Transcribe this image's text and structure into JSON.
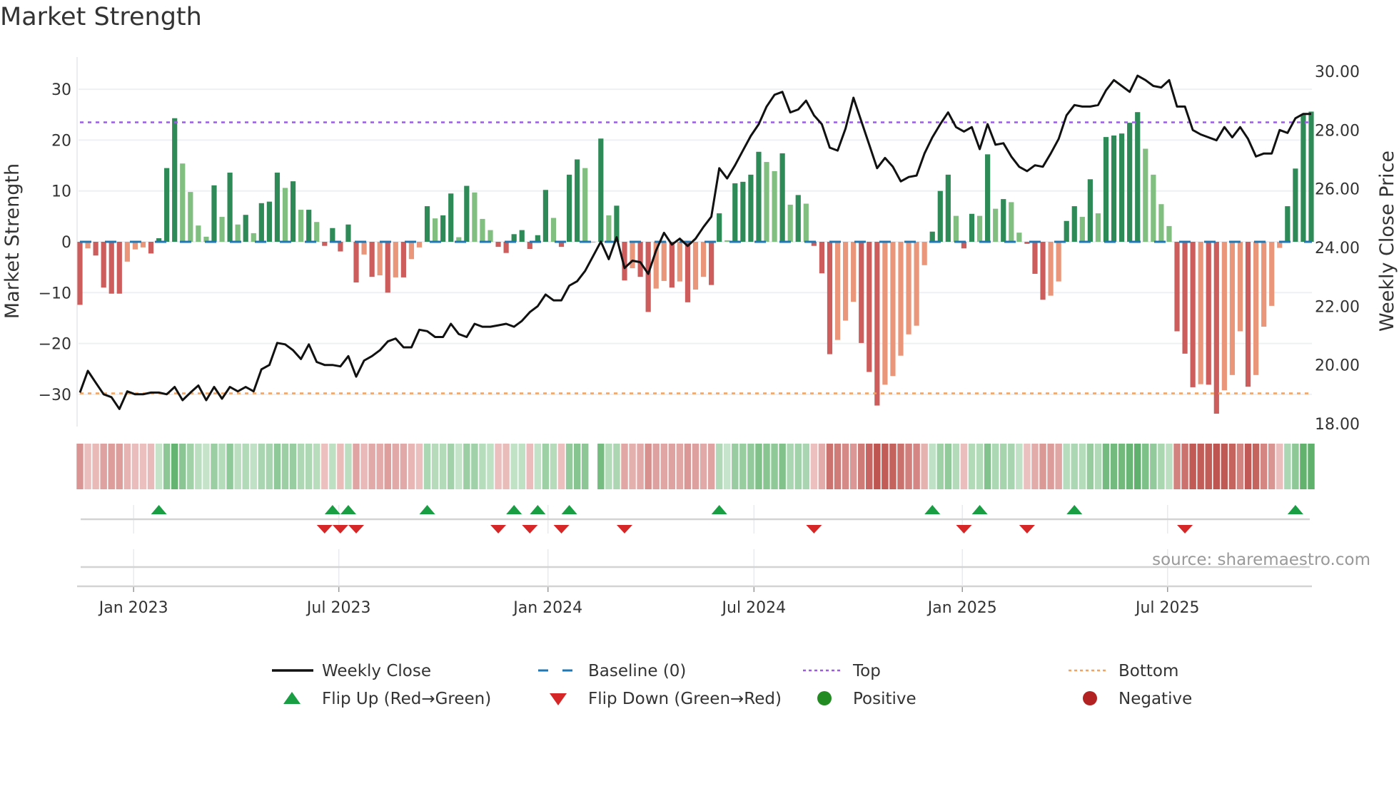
{
  "chart_data": {
    "type": "bar",
    "title": "Market Strength",
    "ylabel": "Market Strength",
    "y2label": "Weekly Close Price",
    "ylim": [
      -37,
      36
    ],
    "y2lim": [
      18,
      30.6
    ],
    "yticks": [
      "30",
      "20",
      "10",
      "0",
      "−10",
      "−20",
      "−30"
    ],
    "ytick_values": [
      30,
      20,
      10,
      0,
      -10,
      -20,
      -30
    ],
    "y2ticks": [
      "30.00",
      "28.00",
      "26.00",
      "24.00",
      "22.00",
      "20.00",
      "18.00"
    ],
    "y2tick_values": [
      30,
      28,
      26,
      24,
      22,
      20,
      18
    ],
    "xticks": [
      "Jan 2023",
      "Jul 2023",
      "Jan 2024",
      "Jul 2024",
      "Jan 2025",
      "Jul 2025"
    ],
    "xtick_week_index": [
      6.8,
      32.8,
      59.3,
      85.4,
      111.8,
      137.8
    ],
    "top_level": 23.5,
    "bottom_level": -29.8,
    "baseline": 0,
    "grid": true,
    "legend_placement": "bottom",
    "strength": [
      -12.4,
      -1.3,
      -2.7,
      -9,
      -10.2,
      -10.2,
      -3.9,
      -1.5,
      -1.1,
      -2.3,
      0.7,
      14.5,
      24.3,
      15.4,
      9.8,
      3.2,
      1.0,
      11.1,
      4.9,
      13.6,
      3.4,
      5.3,
      1.7,
      7.6,
      7.9,
      13.6,
      10.6,
      11.9,
      6.3,
      6.3,
      3.9,
      -0.8,
      2.7,
      -1.9,
      3.4,
      -8,
      -2.5,
      -6.9,
      -6.6,
      -10,
      -7,
      -7,
      -3.4,
      -1.1,
      7.0,
      4.6,
      5.2,
      9.5,
      0.9,
      11.0,
      9.7,
      4.5,
      2.3,
      -1,
      -2.2,
      1.5,
      2.3,
      -1.4,
      1.3,
      10.2,
      4.7,
      -1,
      13.2,
      16.2,
      14.5,
      0,
      20.3,
      5.2,
      7.1,
      -7.6,
      -5.2,
      -6.9,
      -13.8,
      -9.2,
      -7.7,
      -9,
      -7.8,
      -11.9,
      -9.4,
      -6.9,
      -8.5,
      5.6,
      0.3,
      11.5,
      11.8,
      13.2,
      17.7,
      15.7,
      13.9,
      17.4,
      7.3,
      9.2,
      7.5,
      -0.8,
      -6.2,
      -22.1,
      -19.3,
      -15.5,
      -11.8,
      -19.9,
      -25.6,
      -32.2,
      -28.1,
      -26.4,
      -22.4,
      -18.2,
      -16.5,
      -4.6,
      2.0,
      10.0,
      13.2,
      5.1,
      -1.3,
      5.5,
      5.1,
      17.2,
      6.5,
      8.4,
      7.8,
      1.8,
      -0.4,
      -6.3,
      -11.4,
      -10.6,
      -7.8,
      4.1,
      7.0,
      4.9,
      12.3,
      5.6,
      20.6,
      20.9,
      21.3,
      23.4,
      25.5,
      18.3,
      13.2,
      7.4,
      3.1,
      -17.6,
      -22.0,
      -28.6,
      -28.0,
      -28.1,
      -33.8,
      -29.2,
      -26.2,
      -17.6,
      -28.5,
      -26.2,
      -16.7,
      -12.6,
      -1.2,
      7.0,
      14.4,
      25.1,
      25.6
    ],
    "weekly_close": [
      19.06,
      19.8,
      19.4,
      19.0,
      18.9,
      18.5,
      19.1,
      19.0,
      19.0,
      19.06,
      19.06,
      19.0,
      19.25,
      18.8,
      19.06,
      19.3,
      18.8,
      19.25,
      18.85,
      19.25,
      19.1,
      19.25,
      19.1,
      19.85,
      20.0,
      20.75,
      20.7,
      20.5,
      20.2,
      20.7,
      20.1,
      20.0,
      20.0,
      19.95,
      20.3,
      19.6,
      20.15,
      20.3,
      20.5,
      20.8,
      20.9,
      20.6,
      20.6,
      21.2,
      21.15,
      20.95,
      20.95,
      21.4,
      21.05,
      20.95,
      21.4,
      21.3,
      21.3,
      21.35,
      21.4,
      21.3,
      21.5,
      21.8,
      22.0,
      22.4,
      22.2,
      22.2,
      22.7,
      22.85,
      23.2,
      23.7,
      24.2,
      23.6,
      24.35,
      23.3,
      23.55,
      23.5,
      23.1,
      23.9,
      24.5,
      24.1,
      24.3,
      24.05,
      24.3,
      24.7,
      25.05,
      26.7,
      26.35,
      26.8,
      27.3,
      27.8,
      28.2,
      28.8,
      29.2,
      29.3,
      28.6,
      28.7,
      29.0,
      28.5,
      28.2,
      27.4,
      27.3,
      28.05,
      29.1,
      28.3,
      27.5,
      26.7,
      27.05,
      26.75,
      26.25,
      26.4,
      26.45,
      27.2,
      27.75,
      28.2,
      28.6,
      28.1,
      27.95,
      28.1,
      27.35,
      28.2,
      27.5,
      27.55,
      27.1,
      26.75,
      26.6,
      26.8,
      26.75,
      27.2,
      27.7,
      28.5,
      28.85,
      28.8,
      28.8,
      28.85,
      29.35,
      29.7,
      29.5,
      29.3,
      29.85,
      29.7,
      29.5,
      29.45,
      29.7,
      28.8,
      28.8,
      28.0,
      27.85,
      27.75,
      27.65,
      28.1,
      27.75,
      28.1,
      27.7,
      27.1,
      27.2,
      27.2,
      28.0,
      27.9,
      28.4,
      28.55,
      28.55
    ],
    "flip_up_week_index": [
      10,
      32,
      34,
      44,
      55,
      58,
      62,
      81,
      108,
      114,
      126,
      154
    ],
    "flip_down_week_index": [
      31,
      33,
      35,
      53,
      57,
      61,
      69,
      93,
      112,
      120,
      140
    ],
    "legend": [
      {
        "label": "Weekly Close",
        "marker": "line",
        "color": "#111111"
      },
      {
        "label": "Baseline (0)",
        "marker": "dash",
        "color": "#1f77b4"
      },
      {
        "label": "Top",
        "marker": "dot",
        "color": "#9b5de5"
      },
      {
        "label": "Bottom",
        "marker": "dot",
        "color": "#f4a261"
      },
      {
        "label": "Flip Up (Red→Green)",
        "marker": "triangle-up",
        "color": "#1a9e44"
      },
      {
        "label": "Flip Down (Green→Red)",
        "marker": "triangle-down",
        "color": "#d62728"
      },
      {
        "label": "Positive",
        "marker": "circle",
        "color": "#228b22"
      },
      {
        "label": "Negative",
        "marker": "circle",
        "color": "#b22222"
      }
    ],
    "colors": {
      "pos_strong": "#2e8b57",
      "pos_weak": "#80bf80",
      "neg_strong": "#cd5c5c",
      "neg_weak": "#e9967a",
      "baseline": "#1f77b4",
      "top": "#9b5de5",
      "bottom": "#f4a261",
      "grid": "#eef0f3",
      "line": "#111111"
    },
    "source": "source: sharemaestro.com"
  }
}
